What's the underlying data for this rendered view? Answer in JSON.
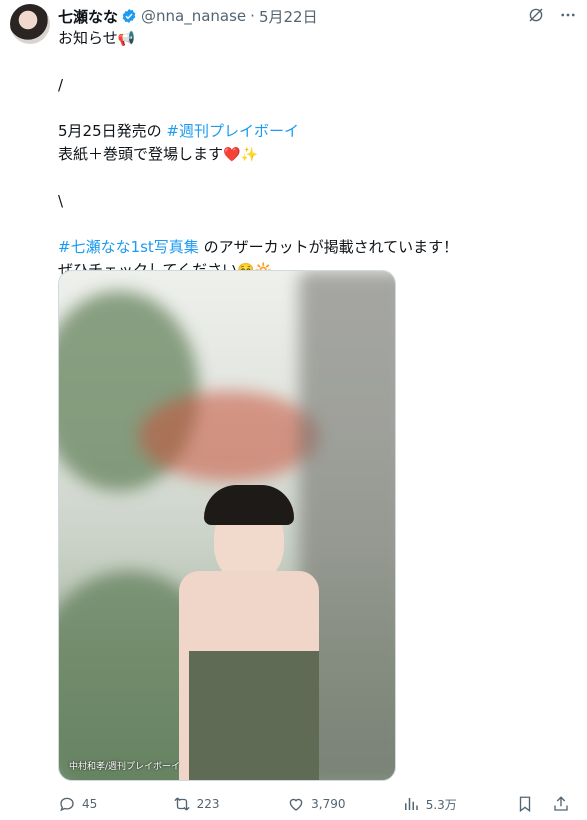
{
  "tweet": {
    "name": "七瀬なな",
    "handle": "@nna_nanase",
    "separator": "·",
    "date": "5月22日",
    "lines": [
      {
        "text": "お知らせ",
        "emoji": "📢"
      },
      {
        "text": ""
      },
      {
        "text": "/"
      },
      {
        "text": ""
      },
      {
        "pre": "5月25日発売の ",
        "link": "#週刊プレイボーイ"
      },
      {
        "text": "表紙＋巻頭で登場します",
        "emoji": "❤️✨"
      },
      {
        "text": ""
      },
      {
        "text": "\\"
      },
      {
        "text": ""
      },
      {
        "link": "#七瀬なな1st写真集",
        "post": " のアザーカットが掲載されています！"
      },
      {
        "text": "ぜひチェックしてください",
        "emoji": "☺️🔆"
      }
    ],
    "photo_credit": "中村和孝/週刊プレイボーイ"
  },
  "actions": {
    "replies": "45",
    "retweets": "223",
    "likes": "3,790",
    "views": "5.3万"
  },
  "colors": {
    "link": "#1d9bf0",
    "muted": "#536471",
    "verified": "#1d9bf0"
  }
}
